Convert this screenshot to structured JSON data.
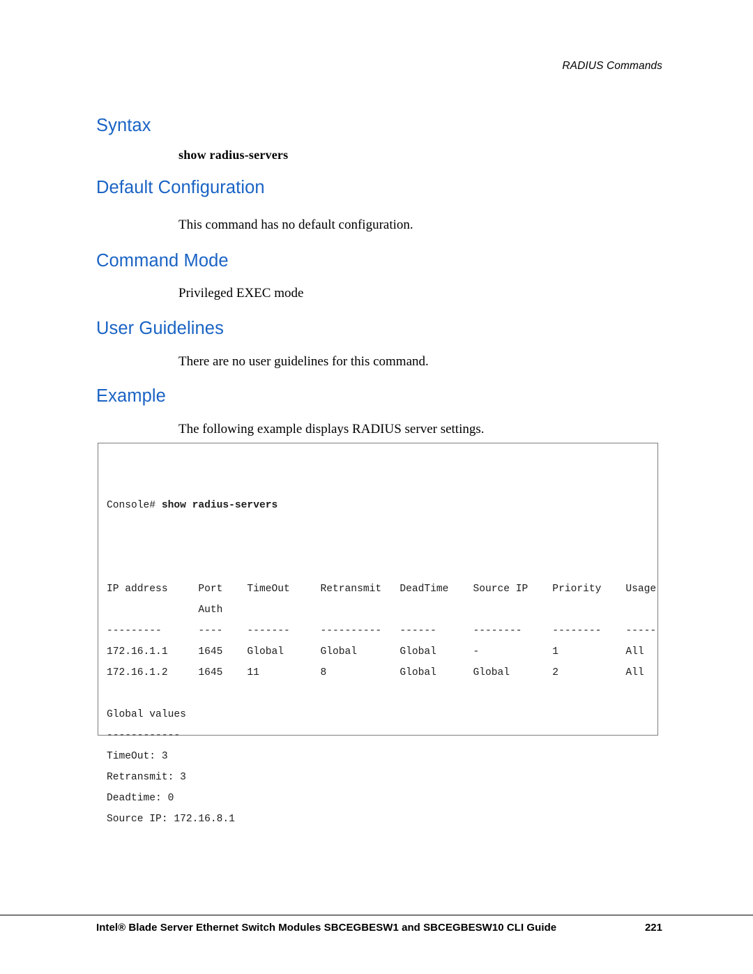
{
  "header": {
    "running_head": "RADIUS Commands"
  },
  "sections": {
    "syntax": {
      "heading": "Syntax",
      "command": "show radius-servers"
    },
    "default_configuration": {
      "heading": "Default Configuration",
      "body": "This command has no default configuration."
    },
    "command_mode": {
      "heading": "Command Mode",
      "body": "Privileged EXEC mode"
    },
    "user_guidelines": {
      "heading": "User Guidelines",
      "body": "There are no user guidelines for this command."
    },
    "example": {
      "heading": "Example",
      "body": "The following example displays RADIUS server settings."
    }
  },
  "console": {
    "prompt": "Console# ",
    "command": "show radius-servers",
    "lines": [
      "",
      "IP address     Port    TimeOut     Retransmit   DeadTime    Source IP    Priority    Usage",
      "               Auth",
      "---------      ----    -------     ----------   ------      --------     --------    -----",
      "172.16.1.1     1645    Global      Global       Global      -            1           All",
      "172.16.1.2     1645    11          8            Global      Global       2           All",
      "",
      "Global values",
      "------------",
      "TimeOut: 3",
      "Retransmit: 3",
      "Deadtime: 0",
      "Source IP: 172.16.8.1"
    ]
  },
  "footer": {
    "left": "Intel® Blade Server Ethernet Switch Modules SBCEGBESW1 and SBCEGBESW10 CLI Guide",
    "page_number": "221"
  }
}
